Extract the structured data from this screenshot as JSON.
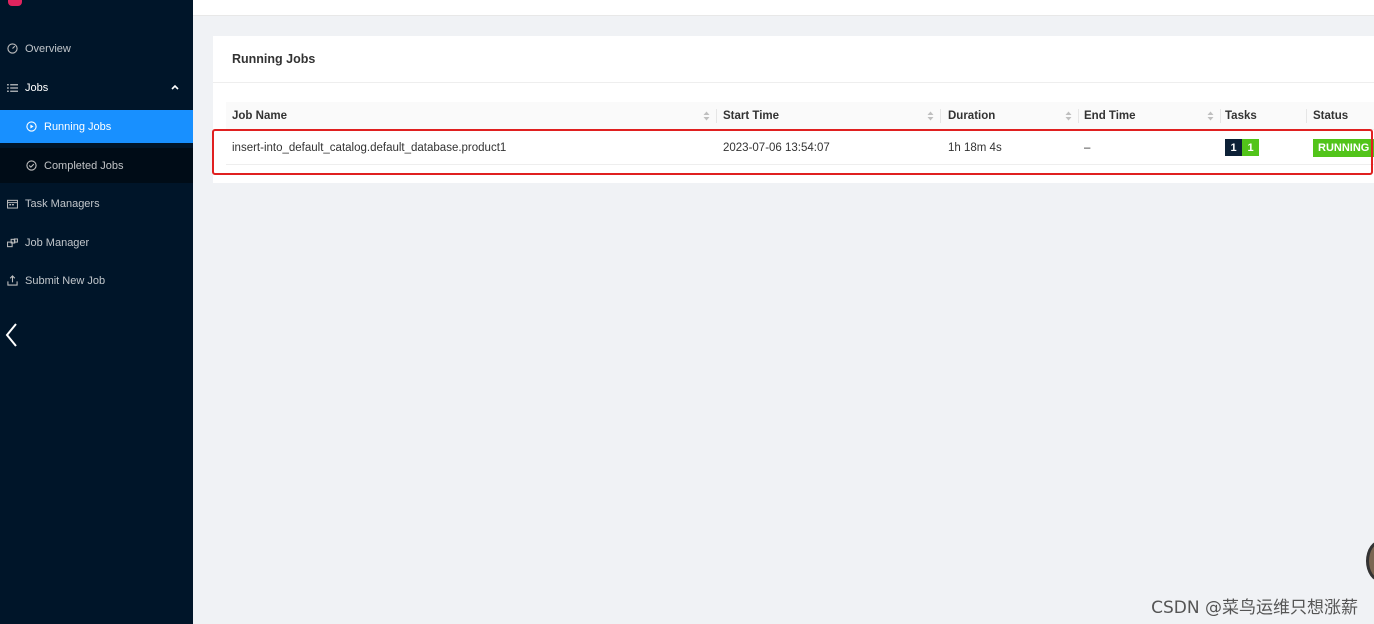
{
  "sidebar": {
    "items": [
      {
        "label": "Overview",
        "icon": "dashboard-icon"
      },
      {
        "label": "Jobs",
        "icon": "list-icon"
      },
      {
        "label": "Running Jobs",
        "icon": "play-circle-icon"
      },
      {
        "label": "Completed Jobs",
        "icon": "check-circle-icon"
      },
      {
        "label": "Task Managers",
        "icon": "schedule-icon"
      },
      {
        "label": "Job Manager",
        "icon": "cluster-icon"
      },
      {
        "label": "Submit New Job",
        "icon": "upload-icon"
      }
    ]
  },
  "card": {
    "title": "Running Jobs",
    "columns": [
      "Job Name",
      "Start Time",
      "Duration",
      "End Time",
      "Tasks",
      "Status"
    ],
    "rows": [
      {
        "job_name": "insert-into_default_catalog.default_database.product1",
        "start_time": "2023-07-06 13:54:07",
        "duration": "1h 18m 4s",
        "end_time": "–",
        "tasks_total": "1",
        "tasks_running": "1",
        "status": "RUNNING"
      }
    ]
  },
  "watermark": "CSDN @菜鸟运维只想涨薪",
  "colors": {
    "sidebar_bg": "#001529",
    "active": "#1890ff",
    "running": "#52c41a",
    "highlight": "#e02020"
  }
}
